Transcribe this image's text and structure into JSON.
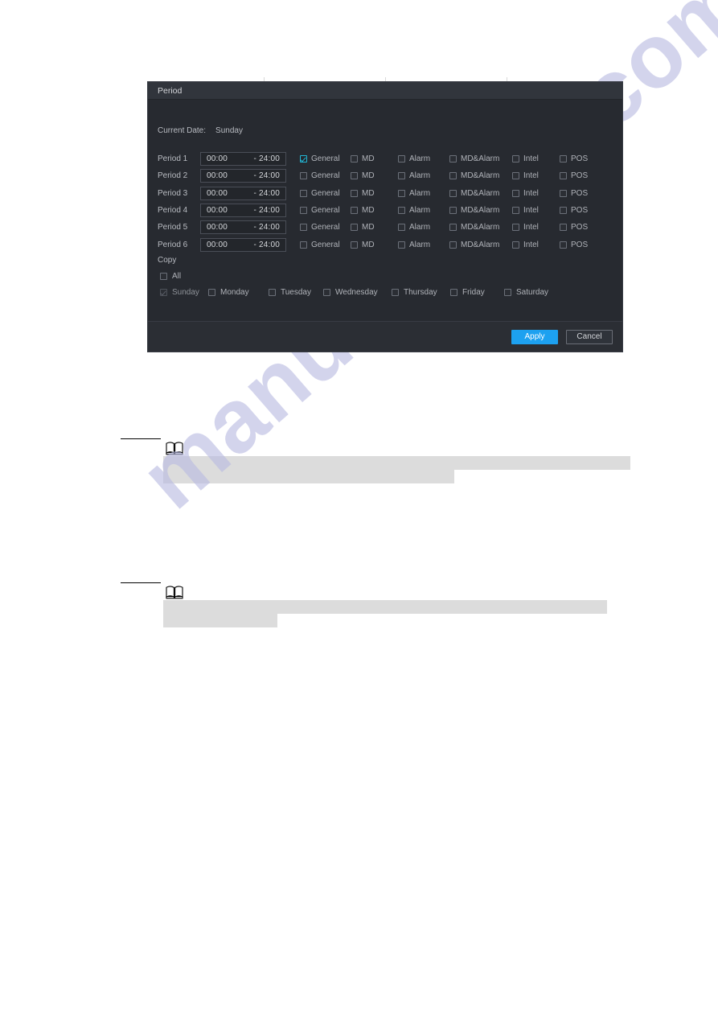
{
  "page": {
    "watermark": "manualshive.com"
  },
  "dialog": {
    "title": "Period",
    "current_date_label": "Current Date:",
    "current_date_value": "Sunday",
    "time_separator": "-",
    "event_columns": [
      "General",
      "MD",
      "Alarm",
      "MD&Alarm",
      "Intel",
      "POS"
    ],
    "periods": [
      {
        "label": "Period 1",
        "start": "00:00",
        "end": "24:00",
        "checks": {
          "General": true,
          "MD": false,
          "Alarm": false,
          "MD&Alarm": false,
          "Intel": false,
          "POS": false
        }
      },
      {
        "label": "Period 2",
        "start": "00:00",
        "end": "24:00",
        "checks": {
          "General": false,
          "MD": false,
          "Alarm": false,
          "MD&Alarm": false,
          "Intel": false,
          "POS": false
        }
      },
      {
        "label": "Period 3",
        "start": "00:00",
        "end": "24:00",
        "checks": {
          "General": false,
          "MD": false,
          "Alarm": false,
          "MD&Alarm": false,
          "Intel": false,
          "POS": false
        }
      },
      {
        "label": "Period 4",
        "start": "00:00",
        "end": "24:00",
        "checks": {
          "General": false,
          "MD": false,
          "Alarm": false,
          "MD&Alarm": false,
          "Intel": false,
          "POS": false
        }
      },
      {
        "label": "Period 5",
        "start": "00:00",
        "end": "24:00",
        "checks": {
          "General": false,
          "MD": false,
          "Alarm": false,
          "MD&Alarm": false,
          "Intel": false,
          "POS": false
        }
      },
      {
        "label": "Period 6",
        "start": "00:00",
        "end": "24:00",
        "checks": {
          "General": false,
          "MD": false,
          "Alarm": false,
          "MD&Alarm": false,
          "Intel": false,
          "POS": false
        }
      }
    ],
    "copy": {
      "label": "Copy",
      "all_label": "All",
      "all_checked": false,
      "weekdays": [
        {
          "label": "Sunday",
          "checked": true,
          "disabled": true
        },
        {
          "label": "Monday",
          "checked": false,
          "disabled": false
        },
        {
          "label": "Tuesday",
          "checked": false,
          "disabled": false
        },
        {
          "label": "Wednesday",
          "checked": false,
          "disabled": false
        },
        {
          "label": "Thursday",
          "checked": false,
          "disabled": false
        },
        {
          "label": "Friday",
          "checked": false,
          "disabled": false
        },
        {
          "label": "Saturday",
          "checked": false,
          "disabled": false
        }
      ]
    },
    "buttons": {
      "apply": "Apply",
      "cancel": "Cancel"
    },
    "colors": {
      "accent_checkbox": "#23b7d6",
      "apply_button": "#1da1f0",
      "dialog_background": "#272a30",
      "titlebar_background": "#31353c"
    }
  },
  "notes": [
    {
      "icon": "book-icon",
      "redacted": true
    },
    {
      "icon": "book-icon",
      "redacted": true
    }
  ]
}
